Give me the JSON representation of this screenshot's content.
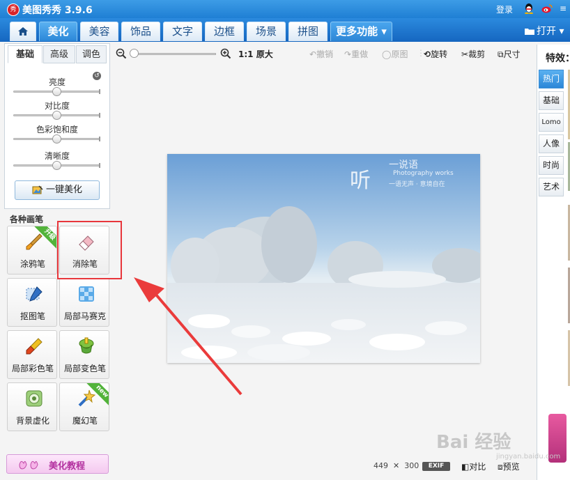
{
  "app": {
    "title": "美图秀秀 3.9.6",
    "logo_text": "秀",
    "login": "登录",
    "menu_glyph": "≡"
  },
  "nav": {
    "tabs": [
      "美化",
      "美容",
      "饰品",
      "文字",
      "边框",
      "场景",
      "拼图"
    ],
    "active": "美化",
    "more": "更多功能 ▾",
    "open": "打开 ▾"
  },
  "adjust": {
    "tabs": [
      "基础",
      "高级",
      "调色"
    ],
    "sliders": [
      {
        "label": "亮度",
        "value": 0.5
      },
      {
        "label": "对比度",
        "value": 0.5
      },
      {
        "label": "色彩饱和度",
        "value": 0.5
      },
      {
        "label": "清晰度",
        "value": 0.5
      }
    ],
    "one_key": "一键美化"
  },
  "brushes": {
    "title": "各种画笔",
    "items": [
      {
        "label": "涂鸦笔",
        "icon": "paintbrush-icon",
        "badge": "升级"
      },
      {
        "label": "消除笔",
        "icon": "eraser-icon",
        "badge": ""
      },
      {
        "label": "抠图笔",
        "icon": "cutout-pen-icon",
        "badge": ""
      },
      {
        "label": "局部马赛克",
        "icon": "mosaic-icon",
        "badge": ""
      },
      {
        "label": "局部彩色笔",
        "icon": "color-brush-icon",
        "badge": ""
      },
      {
        "label": "局部变色笔",
        "icon": "recolor-icon",
        "badge": ""
      },
      {
        "label": "背景虚化",
        "icon": "blur-icon",
        "badge": ""
      },
      {
        "label": "魔幻笔",
        "icon": "magic-wand-icon",
        "badge": "new"
      }
    ]
  },
  "tutorial": "美化教程",
  "toolbar": {
    "zoom_ratio": "1:1",
    "original_size": "原大",
    "undo": "撤销",
    "redo": "重做",
    "original": "原图",
    "rotate": "旋转",
    "crop": "裁剪",
    "resize": "尺寸"
  },
  "image": {
    "text_big": "听",
    "text_script": "一说语",
    "text_en": "Photography works",
    "text_sub": "一语无声 · 意境自在"
  },
  "status": {
    "width": "449",
    "times": "✕",
    "height": "300",
    "exif": "EXIF",
    "compare": "对比",
    "preview": "预览"
  },
  "effects": {
    "title": "特效：",
    "tabs": [
      "热门",
      "基础",
      "Lomo",
      "人像",
      "时尚",
      "艺术"
    ],
    "active": "热门"
  },
  "watermark": {
    "main": "Bai 经验",
    "sub": "jingyan.baidu.com"
  },
  "colors": {
    "accent": "#1f7fd4",
    "highlight": "#e8363b"
  }
}
